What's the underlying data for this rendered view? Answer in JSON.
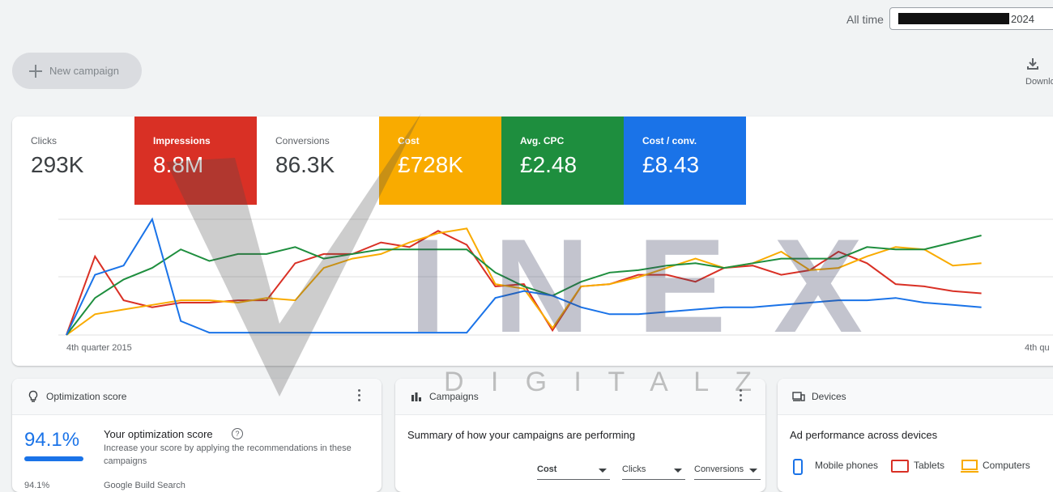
{
  "header": {
    "date_range_label": "All time",
    "date_range_value": "2024"
  },
  "toolbar": {
    "new_campaign_label": "New campaign",
    "download_label": "Download"
  },
  "metrics": [
    {
      "name": "Clicks",
      "value": "293K",
      "selected": false,
      "color": "#ffffff"
    },
    {
      "name": "Impressions",
      "value": "8.8M",
      "selected": true,
      "color": "#d93025"
    },
    {
      "name": "Conversions",
      "value": "86.3K",
      "selected": false,
      "color": "#ffffff"
    },
    {
      "name": "Cost",
      "value": "£728K",
      "selected": true,
      "color": "#f9ab00"
    },
    {
      "name": "Avg. CPC",
      "value": "£2.48",
      "selected": true,
      "color": "#1e8e3e"
    },
    {
      "name": "Cost / conv.",
      "value": "£8.43",
      "selected": true,
      "color": "#1a73e8"
    }
  ],
  "chart_data": {
    "type": "line",
    "x_start_label": "4th quarter 2015",
    "x_end_label": "4th qu",
    "grid": true,
    "series": [
      {
        "name": "Impressions",
        "color": "#d93025",
        "values": [
          0,
          68,
          30,
          24,
          28,
          28,
          30,
          30,
          62,
          70,
          70,
          80,
          76,
          90,
          78,
          42,
          44,
          4,
          42,
          44,
          52,
          52,
          46,
          58,
          60,
          52,
          56,
          72,
          62,
          44,
          42,
          38,
          36
        ]
      },
      {
        "name": "Cost",
        "color": "#f9ab00",
        "values": [
          0,
          18,
          22,
          26,
          30,
          30,
          28,
          32,
          30,
          58,
          66,
          70,
          80,
          88,
          92,
          44,
          40,
          6,
          42,
          44,
          50,
          58,
          66,
          58,
          62,
          72,
          56,
          58,
          68,
          76,
          74,
          60,
          62
        ]
      },
      {
        "name": "Avg. CPC",
        "color": "#1e8e3e",
        "values": [
          0,
          32,
          48,
          58,
          74,
          64,
          70,
          70,
          76,
          66,
          70,
          74,
          74,
          74,
          74,
          54,
          42,
          34,
          46,
          54,
          56,
          60,
          62,
          58,
          62,
          66,
          66,
          66,
          76,
          74,
          74,
          80,
          86
        ]
      },
      {
        "name": "Cost / conv.",
        "color": "#1a73e8",
        "values": [
          0,
          52,
          60,
          100,
          12,
          2,
          2,
          2,
          2,
          2,
          2,
          2,
          2,
          2,
          2,
          32,
          38,
          34,
          24,
          18,
          18,
          20,
          22,
          24,
          24,
          26,
          28,
          30,
          30,
          32,
          28,
          26,
          24
        ]
      }
    ]
  },
  "cards": {
    "optimization": {
      "title": "Optimization score",
      "score": "94.1%",
      "score_fraction": 0.941,
      "heading": "Your optimization score",
      "help_glyph": "?",
      "description": "Increase your score by applying the recommendations in these campaigns",
      "row2_score": "94.1%",
      "row2_name": "Google Build Search"
    },
    "campaigns": {
      "title": "Campaigns",
      "summary": "Summary of how your campaigns are performing",
      "dropdowns": [
        "Cost",
        "Clicks",
        "Conversions"
      ]
    },
    "devices": {
      "title": "Devices",
      "heading": "Ad performance across devices",
      "legend": [
        {
          "label": "Mobile phones",
          "color": "#1a73e8",
          "icon": "phone-icon"
        },
        {
          "label": "Tablets",
          "color": "#d93025",
          "icon": "tablet-icon"
        },
        {
          "label": "Computers",
          "color": "#f9ab00",
          "icon": "computer-icon"
        }
      ]
    }
  },
  "watermark": {
    "brand": "INEX",
    "tagline": "D I G I T A L Z"
  }
}
